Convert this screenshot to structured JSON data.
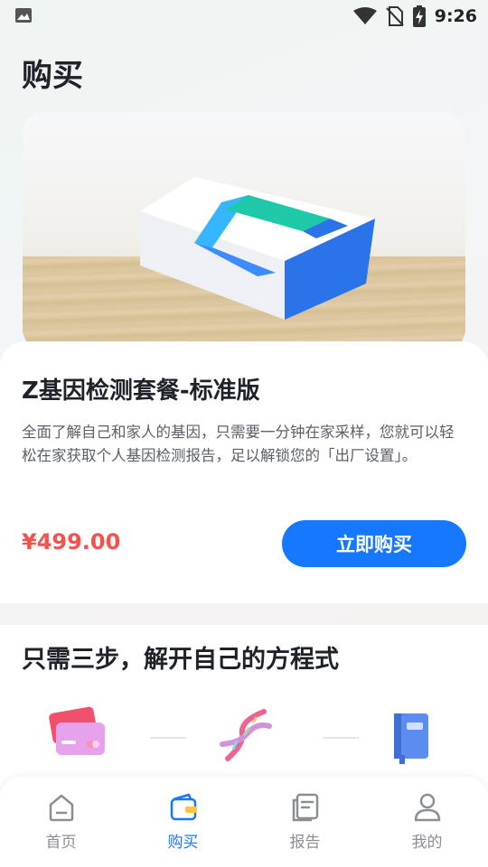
{
  "status_bar": {
    "time": "9:26",
    "icons": [
      "image-notification-icon",
      "wifi-icon",
      "no-sim-icon",
      "battery-charging-icon"
    ]
  },
  "page": {
    "title": "购买"
  },
  "product": {
    "name": "Z基因检测套餐-标准版",
    "description": "全面了解自己和家人的基因，只需要一分钟在家采样，您就可以轻松在家获取个人基因检测报告，足以解锁您的「出厂设置」。",
    "price": "¥499.00",
    "buy_label": "立即购买"
  },
  "steps": {
    "title": "只需三步，解开自己的方程式",
    "items": [
      {
        "icon": "payment-card-icon"
      },
      {
        "icon": "dna-icon"
      },
      {
        "icon": "report-book-icon"
      }
    ]
  },
  "tab_bar": {
    "items": [
      {
        "label": "首页",
        "icon": "home-icon"
      },
      {
        "label": "购买",
        "icon": "wallet-icon",
        "active": true
      },
      {
        "label": "报告",
        "icon": "report-icon"
      },
      {
        "label": "我的",
        "icon": "profile-icon"
      }
    ]
  },
  "colors": {
    "accent": "#1677ff",
    "price": "#f4524d",
    "tab_inactive": "#8a8f96"
  }
}
